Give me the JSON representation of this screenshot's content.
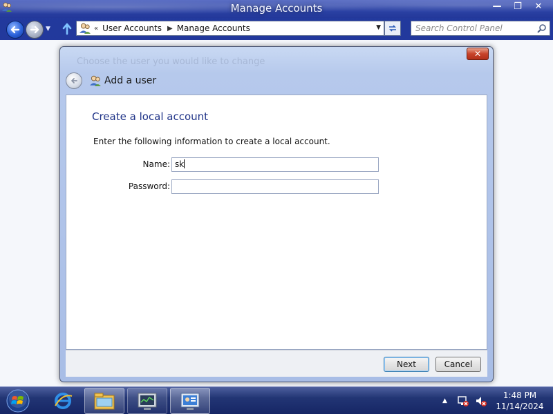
{
  "window": {
    "title": "Manage Accounts",
    "controls": {
      "minimize": "—",
      "restore": "❐",
      "close": "✕"
    }
  },
  "address": {
    "prefix": "«",
    "crumbs": [
      "User Accounts",
      "Manage Accounts"
    ],
    "separator": "▶"
  },
  "search": {
    "placeholder": "Search Control Panel"
  },
  "dialog": {
    "ghost_text": "Choose the user you would like to change",
    "close_label": "✕",
    "title": "Add a user",
    "section_title": "Create a local account",
    "instruction": "Enter the following information to create a local account.",
    "name_label": "Name:",
    "name_value": "sk",
    "password_label": "Password:",
    "password_value": "",
    "next_label": "Next",
    "cancel_label": "Cancel"
  },
  "taskbar": {
    "items": [
      "start-orb-icon",
      "internet-explorer-icon",
      "file-explorer-icon",
      "task-manager-icon",
      "control-panel-icon"
    ],
    "clock_time": "1:48 PM",
    "clock_date": "11/14/2024"
  },
  "colors": {
    "accent": "#1e3287",
    "titlebar": "#2e45a8",
    "taskbar": "#223574",
    "close_red": "#c7432a"
  }
}
